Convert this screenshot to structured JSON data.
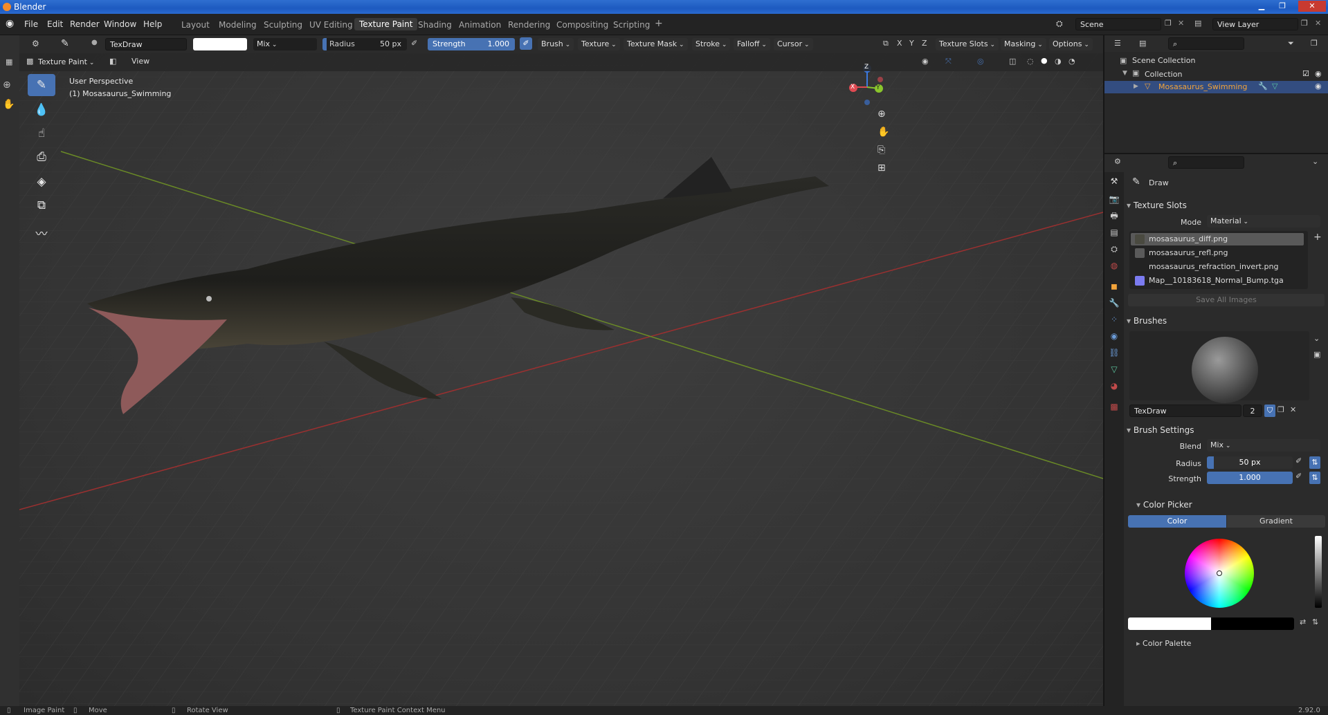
{
  "window": {
    "title": "Blender",
    "min": "▁",
    "max": "❐",
    "close": "✕"
  },
  "menu": [
    "File",
    "Edit",
    "Render",
    "Window",
    "Help"
  ],
  "workspaces": [
    "Layout",
    "Modeling",
    "Sculpting",
    "UV Editing",
    "Texture Paint",
    "Shading",
    "Animation",
    "Rendering",
    "Compositing",
    "Scripting"
  ],
  "workspace_add": "+",
  "scene": {
    "name": "Scene",
    "view_layer": "View Layer"
  },
  "toolhdr": {
    "brush_name": "TexDraw",
    "blend": "Mix",
    "radius_label": "Radius",
    "radius_value": "50 px",
    "strength_label": "Strength",
    "strength_value": "1.000",
    "brush": "Brush",
    "texture": "Texture",
    "texture_mask": "Texture Mask",
    "stroke": "Stroke",
    "falloff": "Falloff",
    "cursor": "Cursor",
    "x": "X",
    "y": "Y",
    "z": "Z",
    "texture_slots": "Texture Slots",
    "masking": "Masking",
    "options": "Options"
  },
  "modehdr": {
    "mode": "Texture Paint",
    "view": "View"
  },
  "viewport": {
    "perspective": "User Perspective",
    "object": "(1) Mosasaurus_Swimming",
    "gizmo_x": "X",
    "gizmo_y": "Y",
    "gizmo_z": "Z"
  },
  "outliner": {
    "scene_collection": "Scene Collection",
    "collection": "Collection",
    "object": "Mosasaurus_Swimming"
  },
  "props": {
    "tool_name": "Draw",
    "texture_slots": {
      "title": "Texture Slots",
      "mode_label": "Mode",
      "mode_value": "Material",
      "items": [
        "mosasaurus_diff.png",
        "mosasaurus_refl.png",
        "mosasaurus_refraction_invert.png",
        "Map__10183618_Normal_Bump.tga"
      ],
      "save_all": "Save All Images"
    },
    "brushes": {
      "title": "Brushes",
      "name": "TexDraw",
      "users": "2"
    },
    "brush_settings": {
      "title": "Brush Settings",
      "blend_label": "Blend",
      "blend_value": "Mix",
      "radius_label": "Radius",
      "radius_value": "50 px",
      "strength_label": "Strength",
      "strength_value": "1.000"
    },
    "color_picker": {
      "title": "Color Picker",
      "color_tab": "Color",
      "gradient_tab": "Gradient"
    },
    "color_palette": {
      "title": "Color Palette"
    }
  },
  "statusbar": {
    "image_paint": "Image Paint",
    "move": "Move",
    "rotate_view": "Rotate View",
    "context_menu": "Texture Paint Context Menu",
    "version": "2.92.0"
  },
  "colors": {
    "accent": "#4772b3",
    "selected_object": "#f2a33a",
    "gizmo_x": "#e04a52",
    "gizmo_y": "#8ac52c",
    "gizmo_z": "#3c7ae0"
  }
}
